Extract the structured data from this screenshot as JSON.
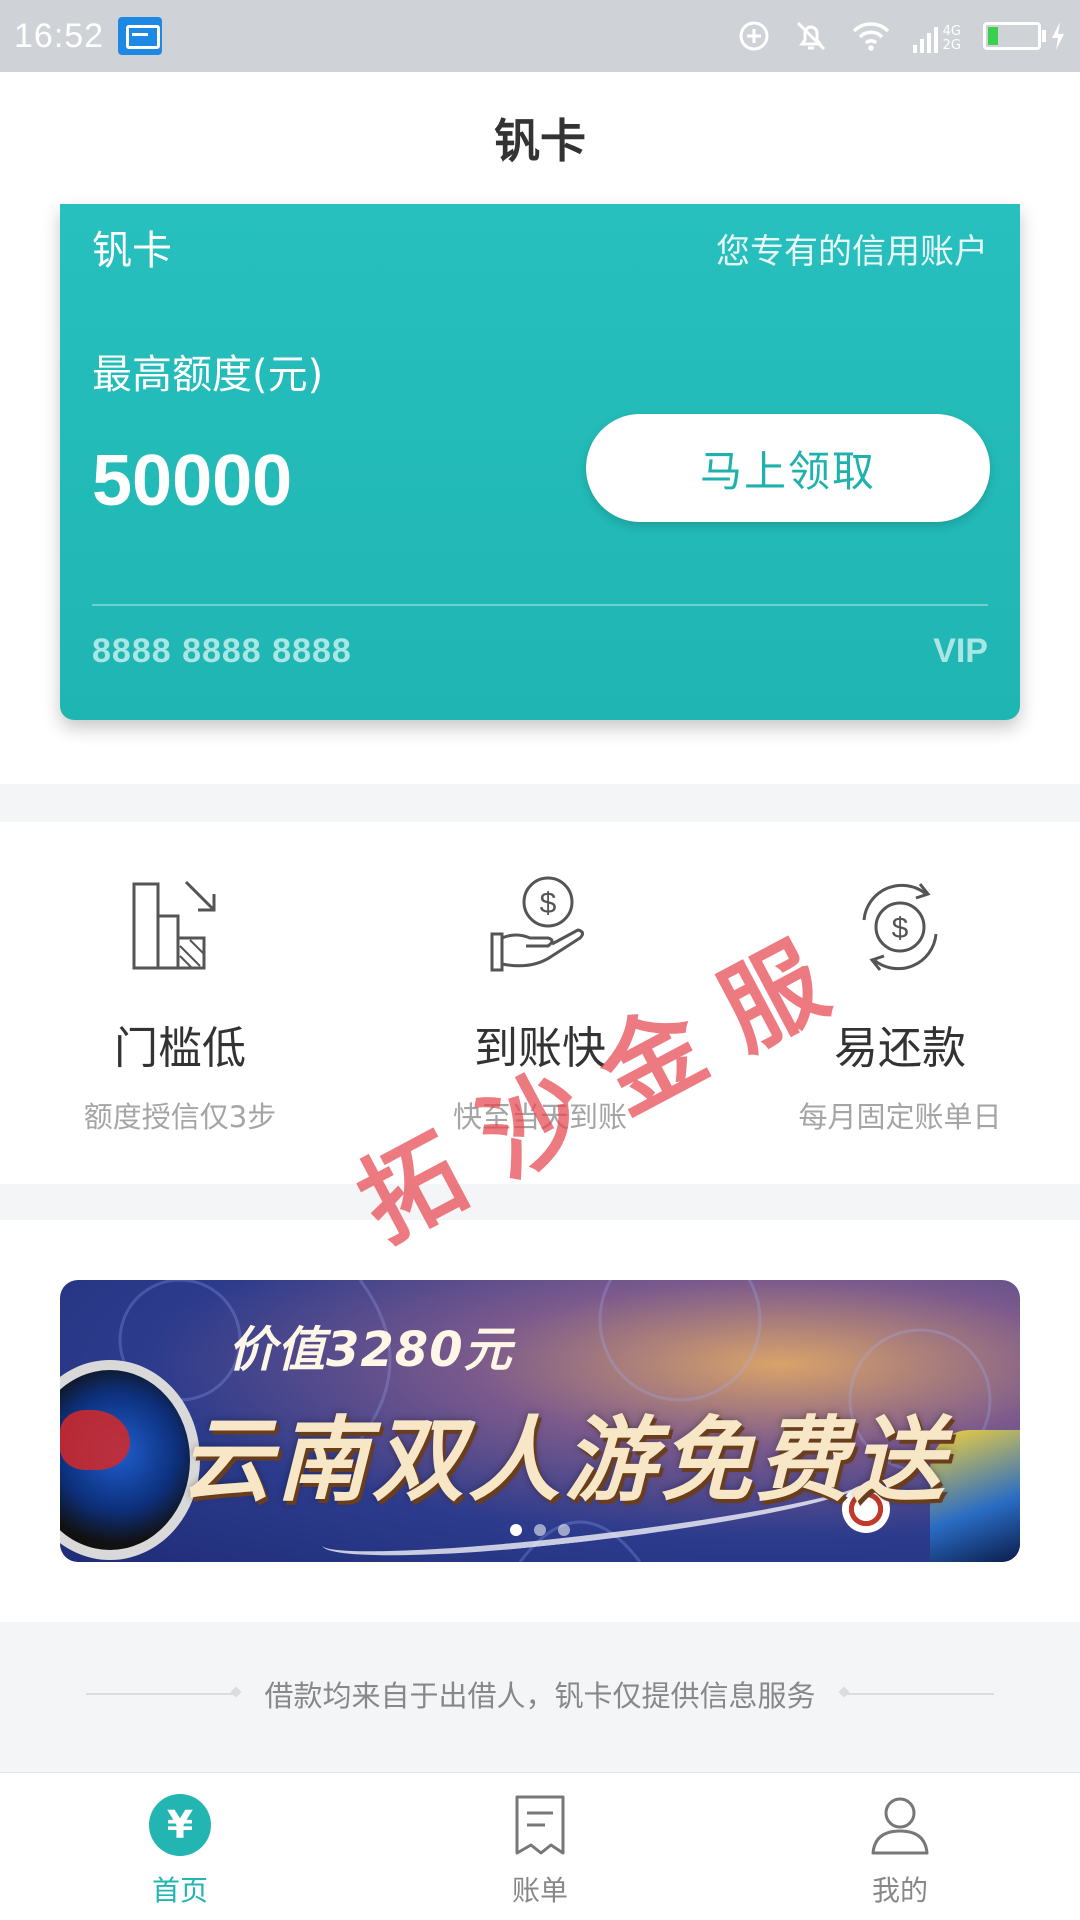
{
  "status_bar": {
    "time": "16:52",
    "icons": [
      "message-icon",
      "data-saver-icon",
      "mute-bell-icon",
      "wifi-icon",
      "signal-icon",
      "battery-charging-icon"
    ],
    "network_labels": [
      "4G",
      "2G"
    ]
  },
  "header": {
    "title": "钒卡"
  },
  "card": {
    "name": "钒卡",
    "tagline": "您专有的信用账户",
    "limit_label": "最高额度(元)",
    "amount": "50000",
    "claim_button": "马上领取",
    "card_number": "8888 8888 8888",
    "tier": "VIP",
    "color": "#1fb5b2"
  },
  "features": [
    {
      "icon": "low-threshold-icon",
      "title": "门槛低",
      "subtitle": "额度授信仅3步"
    },
    {
      "icon": "hand-dollar-icon",
      "title": "到账快",
      "subtitle": "快至当天到账"
    },
    {
      "icon": "repay-cycle-dollar-icon",
      "title": "易还款",
      "subtitle": "每月固定账单日"
    }
  ],
  "watermark": "拓沙金服",
  "banner": {
    "price_text": "价值3280元",
    "headline": "云南双人游免费送",
    "slide_count": 3,
    "active_slide": 1
  },
  "disclaimer": "借款均来自于出借人，钒卡仅提供信息服务",
  "bottom_nav": [
    {
      "icon": "yuan-circle-icon",
      "label": "首页",
      "active": true
    },
    {
      "icon": "bill-icon",
      "label": "账单",
      "active": false
    },
    {
      "icon": "user-icon",
      "label": "我的",
      "active": false
    }
  ],
  "accent_color": "#22b5b2"
}
